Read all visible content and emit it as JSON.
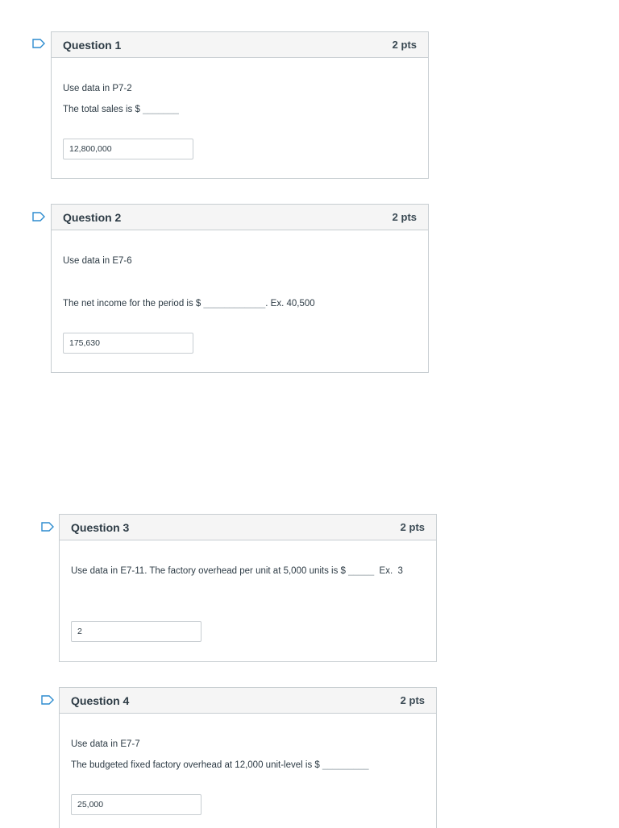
{
  "questions": [
    {
      "title": "Question 1",
      "points": "2 pts",
      "lines": [
        "Use data in P7-2",
        "The total sales is $ "
      ],
      "blank": "_______",
      "answer": "12,800,000"
    },
    {
      "title": "Question 2",
      "points": "2 pts",
      "lines": [
        "Use data in E7-6",
        "The net income for the period is $ "
      ],
      "blank": "____________",
      "suffix": ". Ex. 40,500",
      "answer": "175,630"
    },
    {
      "title": "Question 3",
      "points": "2 pts",
      "lines": [
        "Use data in E7-11. The factory overhead per unit at 5,000 units is $ "
      ],
      "blank": "_____",
      "suffix": "  Ex.  3",
      "answer": "2"
    },
    {
      "title": "Question 4",
      "points": "2 pts",
      "lines": [
        "Use data in E7-7",
        "The budgeted fixed factory overhead at 12,000 unit-level is $ "
      ],
      "blank": "_________",
      "answer": "25,000"
    }
  ],
  "icons": {
    "flag": "flag-question-icon"
  },
  "colors": {
    "border": "#c7cdd1",
    "header_bg": "#f5f5f5",
    "flag": "#2d8ccf"
  }
}
